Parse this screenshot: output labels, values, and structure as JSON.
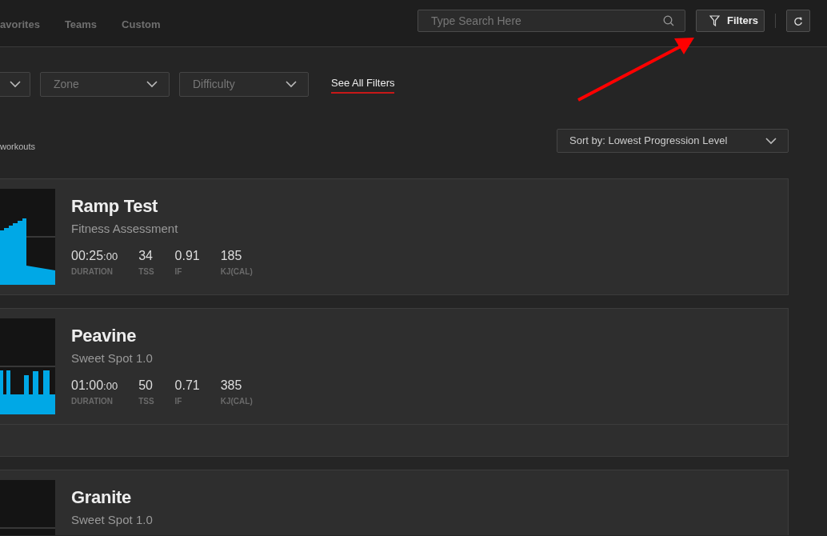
{
  "tabs": [
    {
      "label": "avorites"
    },
    {
      "label": "Teams"
    },
    {
      "label": "Custom"
    }
  ],
  "search": {
    "placeholder": "Type Search Here"
  },
  "filters_button": "Filters",
  "filter_dropdowns": [
    {
      "kind": "cut"
    },
    {
      "kind": "select",
      "placeholder": "Zone"
    },
    {
      "kind": "select",
      "placeholder": "Difficulty"
    }
  ],
  "see_all_filters": "See All Filters",
  "results_text": "workouts",
  "sort": "Sort by: Lowest Progression Level",
  "workouts": [
    {
      "title": "Ramp Test",
      "subtitle": "Fitness Assessment",
      "kind": "ramp",
      "has_footer": false,
      "stats": [
        {
          "value": "00:25",
          "small": ":00",
          "label": "DURATION"
        },
        {
          "value": "34",
          "label": "TSS"
        },
        {
          "value": "0.91",
          "label": "IF"
        },
        {
          "value": "185",
          "label": "KJ(CAL)"
        }
      ]
    },
    {
      "title": "Peavine",
      "subtitle": "Sweet Spot 1.0",
      "kind": "intervals",
      "has_footer": true,
      "stats": [
        {
          "value": "01:00",
          "small": ":00",
          "label": "DURATION"
        },
        {
          "value": "50",
          "label": "TSS"
        },
        {
          "value": "0.71",
          "label": "IF"
        },
        {
          "value": "385",
          "label": "KJ(CAL)"
        }
      ]
    },
    {
      "title": "Granite",
      "subtitle": "Sweet Spot 1.0",
      "kind": "short-intervals"
    }
  ]
}
